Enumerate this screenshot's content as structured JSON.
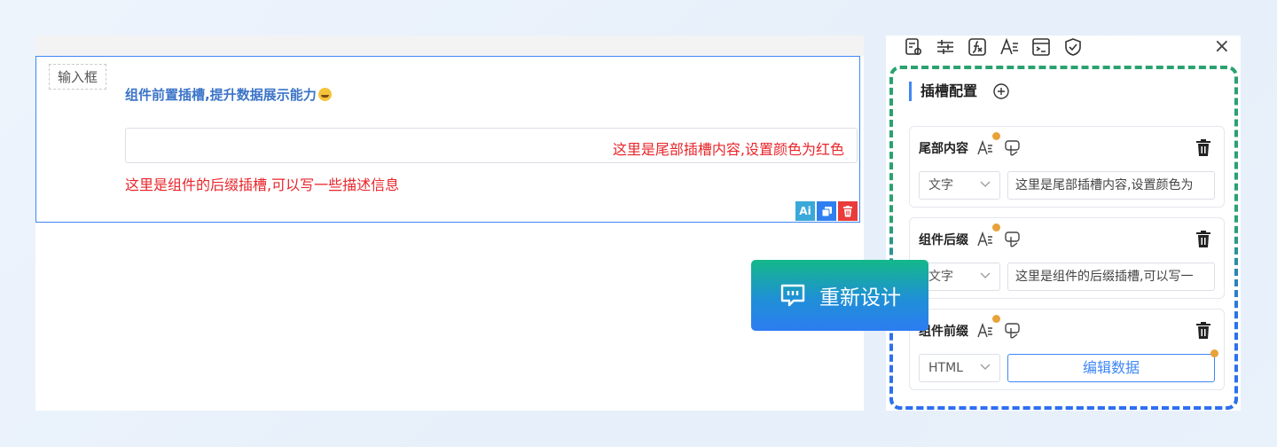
{
  "canvas": {
    "field_label": "输入框",
    "prefix_text": "组件前置插槽,提升数据展示能力",
    "input_suffix": "这里是尾部插槽内容,设置颜色为红色",
    "suffix_description": "这里是组件的后缀插槽,可以写一些描述信息",
    "tool_ai_label": "Ai"
  },
  "panel": {
    "toolbar_icons": [
      "form-settings-icon",
      "sliders-icon",
      "function-icon",
      "text-style-icon",
      "code-window-icon",
      "shield-check-icon"
    ],
    "close_label": "×",
    "section_title": "插槽配置",
    "slots": [
      {
        "name": "尾部内容",
        "type": "文字",
        "value": "这里是尾部插槽内容,设置颜色为"
      },
      {
        "name": "组件后缀",
        "type": "文字",
        "value": "这里是组件的后缀插槽,可以写一"
      },
      {
        "name": "组件前缀",
        "type": "HTML",
        "action_label": "编辑数据"
      }
    ]
  },
  "redesign_button": {
    "label": "重新设计"
  },
  "colors": {
    "accent": "#3f87f5",
    "danger_text": "#e8262b",
    "prefix_text": "#3b74c7",
    "dot": "#e8a23a",
    "outline_green": "#2aa26f",
    "outline_blue": "#2e6ff0"
  }
}
